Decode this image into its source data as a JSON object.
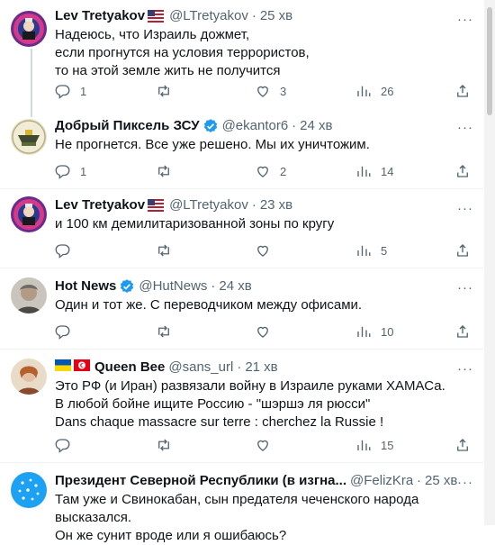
{
  "tweets": [
    {
      "name": "Lev Tretyakov",
      "handle": "@LTretyakov",
      "time": "25 хв",
      "text": "Надеюсь, что Израиль дожмет,\nесли прогнутся на условия террористов,\nто на этой земле жить не получится",
      "replies": "1",
      "retweets": "",
      "likes": "3",
      "views": "26"
    },
    {
      "name": "Добрый Пиксель ЗСУ",
      "handle": "@ekantor6",
      "time": "24 хв",
      "text": "Не прогнется. Все уже решено. Мы их уничтожим.",
      "replies": "1",
      "retweets": "",
      "likes": "2",
      "views": "14"
    },
    {
      "name": "Lev Tretyakov",
      "handle": "@LTretyakov",
      "time": "23 хв",
      "text": "и 100 км демилитаризованной зоны по кругу",
      "replies": "",
      "retweets": "",
      "likes": "",
      "views": "5"
    },
    {
      "name": "Hot News",
      "handle": "@HutNews",
      "time": "24 хв",
      "text": "Один и тот же.  С переводчиком между офисами.",
      "replies": "",
      "retweets": "",
      "likes": "",
      "views": "10"
    },
    {
      "name": "Queen Bee",
      "handle": "@sans_url",
      "time": "21 хв",
      "text": "Это РФ (и Иран) развязали войну в Израиле руками ХАМАСа.\nВ любой бойне ищите Россию - \"шэршэ ля рюсси\"\nDans chaque massacre sur terre : cherchez la Russie !",
      "replies": "",
      "retweets": "",
      "likes": "",
      "views": "15"
    },
    {
      "name": "Президент Северной Республики (в изгна...",
      "handle": "@FelizKra...",
      "time": "25 хв",
      "text": "Там уже и Свинокабан, сын предателя чеченского народа высказался.\nОн же сунит вроде или я ошибаюсь?"
    }
  ],
  "menu_label": "···",
  "dot": "·",
  "colors": {
    "verified": "#1d9bf0",
    "secondary_text": "#536471",
    "divider": "#eff3f4",
    "thread_line": "#cfd9de"
  },
  "icons": [
    "reply-icon",
    "retweet-icon",
    "like-icon",
    "views-icon",
    "share-icon",
    "verified-badge-icon"
  ]
}
